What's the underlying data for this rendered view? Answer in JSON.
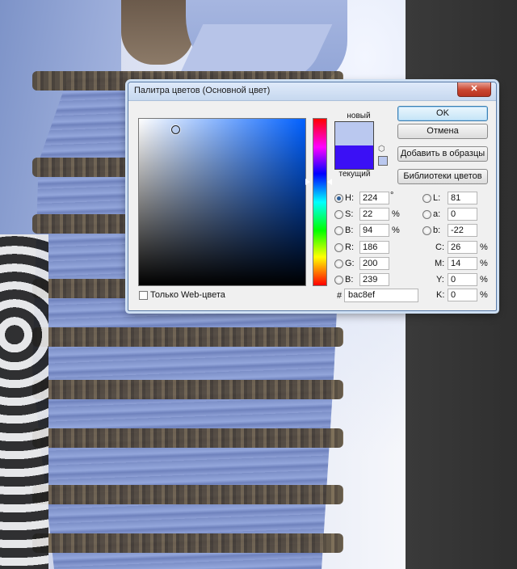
{
  "background": {
    "photo_colors": {
      "dress_blue": "#8ea0d6",
      "lace_brown": "#4c3f2c"
    }
  },
  "dialog": {
    "title": "Палитра цветов (Основной цвет)",
    "close_glyph": "✕",
    "swatch": {
      "new_label": "новый",
      "current_label": "текущий",
      "new_color": "#bac8ef",
      "current_color": "#3b10f5"
    },
    "buttons": {
      "ok": "OK",
      "cancel": "Отмена",
      "add_to_swatches": "Добавить в образцы",
      "color_libraries": "Библиотеки цветов"
    },
    "hsb": {
      "h_label": "H:",
      "h_value": "224",
      "h_unit": "°",
      "s_label": "S:",
      "s_value": "22",
      "s_unit": "%",
      "b_label": "B:",
      "b_value": "94",
      "b_unit": "%"
    },
    "rgb": {
      "r_label": "R:",
      "r_value": "186",
      "g_label": "G:",
      "g_value": "200",
      "b_label": "B:",
      "b_value": "239"
    },
    "lab": {
      "l_label": "L:",
      "l_value": "81",
      "a_label": "a:",
      "a_value": "0",
      "b_label": "b:",
      "b_value": "-22"
    },
    "cmyk": {
      "c_label": "C:",
      "c_value": "26",
      "c_unit": "%",
      "m_label": "M:",
      "m_value": "14",
      "m_unit": "%",
      "y_label": "Y:",
      "y_value": "0",
      "y_unit": "%",
      "k_label": "K:",
      "k_value": "0",
      "k_unit": "%"
    },
    "web_only_label": "Только Web-цвета",
    "hex_label": "#",
    "hex_value": "bac8ef",
    "icons": {
      "gamut": "cube-icon"
    }
  }
}
